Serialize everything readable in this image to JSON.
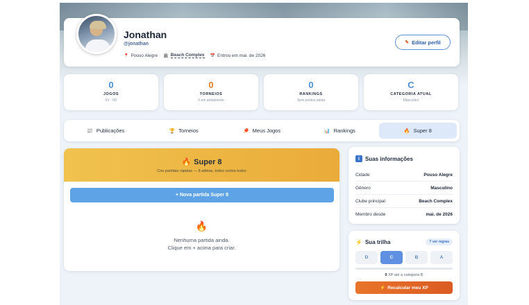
{
  "profile": {
    "name": "Jonathan",
    "handle": "@jonathan",
    "city": "Pouso Alegre",
    "club": "Beach Complex",
    "joined": "Entrou em mai. de 2026",
    "edit_label": "Editar perfil"
  },
  "stats": [
    {
      "value": "0",
      "label": "JOGOS",
      "sub": "0V · 0D",
      "color": "#4d8fe0"
    },
    {
      "value": "0",
      "label": "TORNEIOS",
      "sub": "0 em andamento",
      "color": "#e8802a"
    },
    {
      "value": "0",
      "label": "RANKINGS",
      "sub": "Sem pontos ainda",
      "color": "#4d8fe0"
    },
    {
      "value": "C",
      "label": "CATEGORIA ATUAL",
      "sub": "Masculino",
      "color": "#4d8fe0"
    }
  ],
  "tabs": [
    {
      "label": "Publicações",
      "icon": "newspaper-icon"
    },
    {
      "label": "Torneios",
      "icon": "trophy-icon"
    },
    {
      "label": "Meus Jogos",
      "icon": "racket-icon"
    },
    {
      "label": "Rankings",
      "icon": "bar-chart-icon"
    },
    {
      "label": "Super 8",
      "icon": "flame-icon",
      "active": true
    }
  ],
  "super8": {
    "title": "Super 8",
    "subtitle": "Crie partidas rápidas — 8 atletas, todos contra todos",
    "new_button": "+ Nova partida Super 8",
    "empty_line1": "Nenhuma partida ainda.",
    "empty_line2": "Clique em + acima para criar."
  },
  "info": {
    "title": "Suas informações",
    "rows": [
      {
        "key": "Cidade",
        "value": "Pouso Alegre"
      },
      {
        "key": "Gênero",
        "value": "Masculino"
      },
      {
        "key": "Clube principal",
        "value": "Beach Complex"
      },
      {
        "key": "Membro desde",
        "value": "mai. de 2026"
      }
    ]
  },
  "trilha": {
    "title": "Sua trilha",
    "rules_label": "ver regras",
    "levels": [
      {
        "label": "D"
      },
      {
        "label": "C",
        "active": true
      },
      {
        "label": "B"
      },
      {
        "label": "A"
      }
    ],
    "progress": 0,
    "xp_value": "0",
    "xp_text": "XP até a categoria B",
    "recalc_label": "Recalcular meu XP"
  }
}
